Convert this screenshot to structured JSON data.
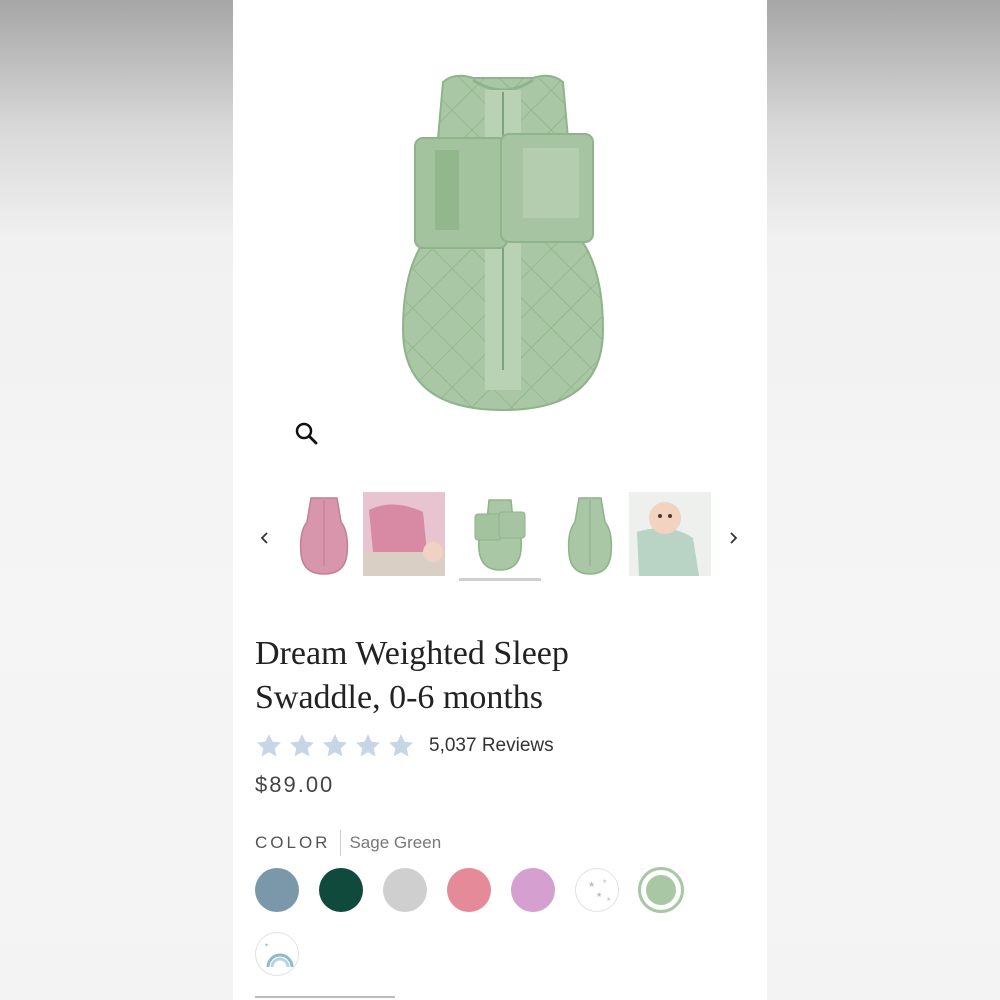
{
  "product": {
    "title_line1": "Dream Weighted Sleep",
    "title_line2": "Swaddle, 0-6 months",
    "reviews_text": "5,037 Reviews",
    "rating": 5,
    "rating_max": 5,
    "price": "$89.00"
  },
  "color": {
    "label": "COLOR",
    "selected": "Sage Green",
    "swatches": [
      {
        "name": "blue",
        "color": "#7b97aa"
      },
      {
        "name": "emerald",
        "color": "#0f4a3c"
      },
      {
        "name": "grey",
        "color": "#cfcfcf"
      },
      {
        "name": "pink",
        "color": "#e48a98"
      },
      {
        "name": "mauve",
        "color": "#d5a0cf"
      },
      {
        "name": "stars-print",
        "color": "#ffffff"
      },
      {
        "name": "sage-green",
        "color": "#a9c7a4"
      },
      {
        "name": "rainbow-print",
        "color": "#ffffff"
      }
    ]
  },
  "colors": {
    "sage": "#a9c7a4",
    "sage_dark": "#8fb38a",
    "star": "#c6d6e7"
  },
  "icons": {
    "zoom": "magnifier-icon",
    "prev": "chevron-left-icon",
    "next": "chevron-right-icon",
    "star": "star-icon"
  }
}
